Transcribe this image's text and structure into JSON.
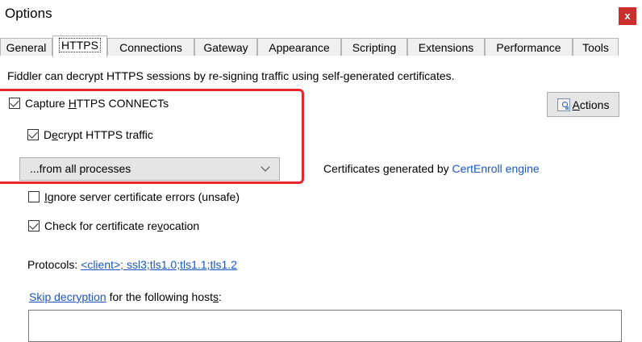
{
  "window": {
    "title": "Options",
    "close_label": "x"
  },
  "tabs": [
    {
      "label": "General"
    },
    {
      "label": "HTTPS",
      "active": true
    },
    {
      "label": "Connections"
    },
    {
      "label": "Gateway"
    },
    {
      "label": "Appearance"
    },
    {
      "label": "Scripting"
    },
    {
      "label": "Extensions"
    },
    {
      "label": "Performance"
    },
    {
      "label": "Tools"
    }
  ],
  "https": {
    "info_text": "Fiddler can decrypt HTTPS sessions by re-signing traffic using self-generated certificates.",
    "capture_connects": {
      "pre": "Capture ",
      "accel": "H",
      "post": "TTPS CONNECTs",
      "checked": true
    },
    "decrypt_traffic": {
      "pre": "D",
      "accel": "e",
      "post": "crypt HTTPS traffic",
      "checked": true
    },
    "process_filter": {
      "selected": "...from all processes"
    },
    "actions": {
      "accel": "A",
      "post": "ctions",
      "icon": "certificate-actions-icon"
    },
    "cert_info": {
      "prefix": "Certificates generated by ",
      "engine_link": "CertEnroll engine"
    },
    "ignore_errors": {
      "accel": "I",
      "post": "gnore server certificate errors (unsafe)",
      "checked": false
    },
    "check_revocation": {
      "pre": "Check for certificate re",
      "accel": "v",
      "post": "ocation",
      "checked": true
    },
    "protocols": {
      "label": "Protocols: ",
      "value": "<client>; ssl3;tls1.0;tls1.1;tls1.2"
    },
    "skip_decryption": {
      "link": "Skip decryption",
      "pre": " for the following host",
      "accel": "s",
      "post": ":"
    },
    "hosts_value": ""
  },
  "colors": {
    "highlight_box": "#e8262b",
    "link": "#1a56c8",
    "close_button": "#c9302c"
  }
}
